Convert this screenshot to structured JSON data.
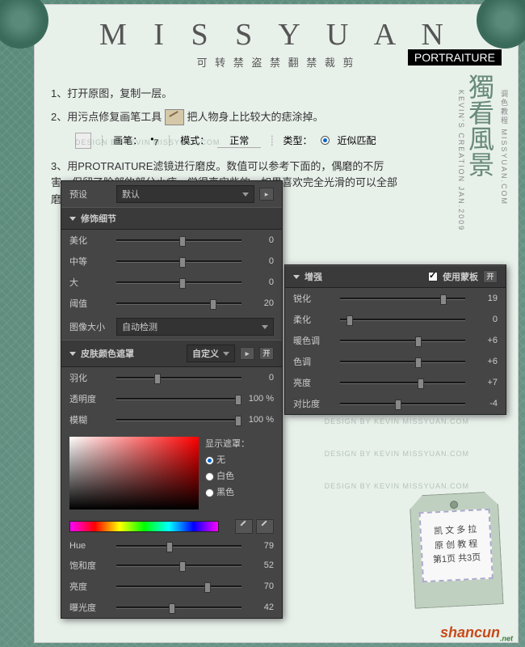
{
  "header": {
    "title": "M I S S Y U A N",
    "subtitle": "可 转 禁 盗 禁 翻 禁 裁 剪",
    "badge": "PORTRAITURE",
    "vertical": "獨看風景",
    "vertical_sub": "KEVIN'S CREATION JAN.2009",
    "vertical_sub2": "调色教程 MISSYUAN.COM"
  },
  "steps": {
    "s1": "1、打开原图，复制一层。",
    "s2a": "2、用污点修复画笔工具",
    "s2b": "把人物身上比较大的痣涂掉。",
    "s3": "3、用PROTRAITURE滤镜进行磨皮。数值可以参考下面的，偶磨的不厉害，保留了脸部的部分小痣，觉得真实些的，如果喜欢完全光滑的可以全部磨掉。"
  },
  "toolbar": {
    "brush": "画笔：",
    "mode": "模式：",
    "mode_val": "正常",
    "type": "类型：",
    "type_val": "近似匹配"
  },
  "panel1": {
    "preset": "预设",
    "preset_val": "默认",
    "detail_hdr": "修饰细节",
    "sliders": [
      {
        "label": "美化",
        "val": "0",
        "pos": 50
      },
      {
        "label": "中等",
        "val": "0",
        "pos": 50
      },
      {
        "label": "大",
        "val": "0",
        "pos": 50
      },
      {
        "label": "阈值",
        "val": "20",
        "pos": 75
      }
    ],
    "img_size": "图像大小",
    "img_size_val": "自动检测",
    "skin_hdr": "皮肤颜色遮罩",
    "skin_val": "自定义",
    "open_btn": "开",
    "skin_sliders": [
      {
        "label": "羽化",
        "val": "0",
        "pos": 30
      },
      {
        "label": "透明度",
        "val": "100 %",
        "pos": 95
      },
      {
        "label": "模糊",
        "val": "100 %",
        "pos": 95
      }
    ],
    "mask_label": "显示遮罩：",
    "mask_opts": [
      "无",
      "白色",
      "黑色"
    ],
    "hsl": [
      {
        "label": "Hue",
        "val": "79",
        "pos": 40
      },
      {
        "label": "饱和度",
        "val": "52",
        "pos": 50
      },
      {
        "label": "亮度",
        "val": "70",
        "pos": 70
      },
      {
        "label": "曝光度",
        "val": "42",
        "pos": 42
      }
    ]
  },
  "panel2": {
    "hdr": "增强",
    "mask_chk": "使用蒙板",
    "open_btn": "开",
    "sliders": [
      {
        "label": "锐化",
        "val": "19",
        "pos": 80
      },
      {
        "label": "柔化",
        "val": "0",
        "pos": 5
      },
      {
        "label": "暖色调",
        "val": "+6",
        "pos": 60
      },
      {
        "label": "色调",
        "val": "+6",
        "pos": 60
      },
      {
        "label": "亮度",
        "val": "+7",
        "pos": 62
      },
      {
        "label": "对比度",
        "val": "-4",
        "pos": 44
      }
    ]
  },
  "tag": {
    "l1": "凯 文 多 拉",
    "l2": "原 创 教 程",
    "l3": "第1页 共3页"
  },
  "watermark": "DESIGN BY KEVIN MISSYUAN.COM",
  "logo": {
    "a": "shan",
    "b": "cun"
  }
}
